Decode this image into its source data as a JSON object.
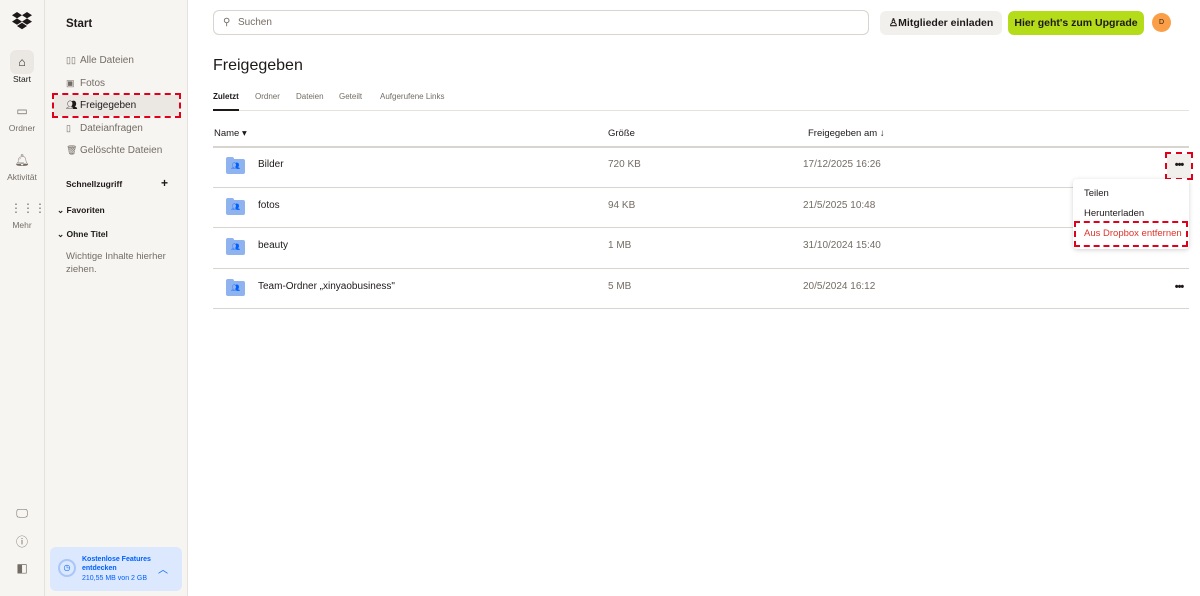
{
  "rail": {
    "items": [
      {
        "label": "Start",
        "icon": "home-icon"
      },
      {
        "label": "Ordner",
        "icon": "folder-icon"
      },
      {
        "label": "Aktivität",
        "icon": "bell-icon"
      },
      {
        "label": "Mehr",
        "icon": "grid-icon"
      }
    ]
  },
  "sidebar": {
    "title": "Start",
    "items": [
      {
        "label": "Alle Dateien"
      },
      {
        "label": "Fotos"
      },
      {
        "label": "Freigegeben"
      },
      {
        "label": "Dateianfragen"
      },
      {
        "label": "Gelöschte Dateien"
      }
    ],
    "quick_access": "Schnellzugriff",
    "favorites": "Favoriten",
    "untitled": "Ohne Titel",
    "hint": "Wichtige Inhalte hierher ziehen.",
    "promo": {
      "title": "Kostenlose Features entdecken",
      "storage": "210,55 MB von 2 GB"
    }
  },
  "header": {
    "search_placeholder": "Suchen",
    "invite": "Mitglieder einladen",
    "upgrade": "Hier geht's zum Upgrade",
    "avatar": "D"
  },
  "main": {
    "title": "Freigegeben",
    "tabs": [
      "Zuletzt",
      "Ordner",
      "Dateien",
      "Geteilt",
      "Aufgerufene Links"
    ],
    "columns": {
      "name": "Name ▾",
      "size": "Größe",
      "date": "Freigegeben am ↓"
    },
    "rows": [
      {
        "name": "Bilder",
        "size": "720 KB",
        "date": "17/12/2025 16:26"
      },
      {
        "name": "fotos",
        "size": "94 KB",
        "date": "21/5/2025 10:48"
      },
      {
        "name": "beauty",
        "size": "1 MB",
        "date": "31/10/2024 15:40"
      },
      {
        "name": "Team-Ordner „xinyaobusiness\"",
        "size": "5 MB",
        "date": "20/5/2024 16:12"
      }
    ],
    "more": "•••",
    "menu": [
      "Teilen",
      "Herunterladen",
      "Aus Dropbox entfernen"
    ]
  },
  "colors": {
    "accent": "#0061fe",
    "upgrade": "#b4dc19",
    "danger": "#e0342c",
    "avatar": "#fa9f47"
  }
}
